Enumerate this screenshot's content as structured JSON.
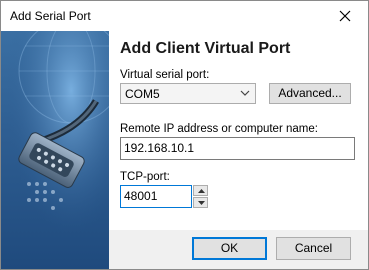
{
  "window": {
    "title": "Add Serial Port",
    "close_icon": "close-icon"
  },
  "dialog": {
    "heading": "Add Client Virtual Port",
    "virtual_port": {
      "label": "Virtual serial port:",
      "value": "COM5",
      "advanced_label": "Advanced..."
    },
    "remote": {
      "label": "Remote IP address or computer name:",
      "value": "192.168.10.1"
    },
    "tcp_port": {
      "label": "TCP-port:",
      "value": "48001"
    }
  },
  "buttons": {
    "ok": "OK",
    "cancel": "Cancel"
  },
  "colors": {
    "side_panel": "#2f5f93",
    "accent": "#0078d7"
  }
}
